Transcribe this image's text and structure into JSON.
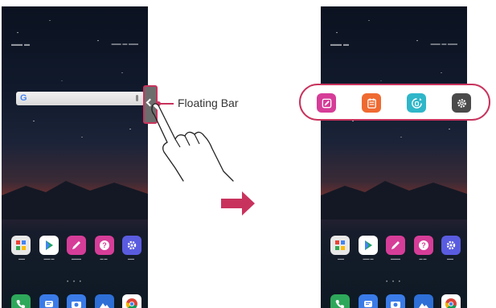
{
  "callout": {
    "label": "Floating Bar"
  },
  "colors": {
    "highlight": "#c8335d",
    "arrow": "#c8335d",
    "memo": "#d63d98",
    "tasks": "#ef6a31",
    "smartcleaning": "#2fb6c9",
    "settings": "#4a4a4a"
  },
  "floating_bar": {
    "items": [
      {
        "name": "quick-memo",
        "icon": "pencil-note-icon"
      },
      {
        "name": "tasks",
        "icon": "notepad-icon"
      },
      {
        "name": "smart-doctor",
        "icon": "refresh-shield-icon"
      },
      {
        "name": "floating-bar-settings",
        "icon": "gear-icon"
      }
    ]
  },
  "home_apps": [
    {
      "name": "google-folder",
      "icon": "folder-grid-icon"
    },
    {
      "name": "play-store",
      "icon": "play-store-icon"
    },
    {
      "name": "quickmemo",
      "icon": "pencil-icon"
    },
    {
      "name": "quick-help",
      "icon": "question-icon"
    },
    {
      "name": "settings",
      "icon": "gear-icon"
    }
  ],
  "dock_apps": [
    {
      "name": "phone",
      "icon": "phone-icon"
    },
    {
      "name": "messages",
      "icon": "message-icon"
    },
    {
      "name": "camera",
      "icon": "camera-icon"
    },
    {
      "name": "gallery",
      "icon": "gallery-icon"
    },
    {
      "name": "chrome",
      "icon": "chrome-icon"
    }
  ]
}
